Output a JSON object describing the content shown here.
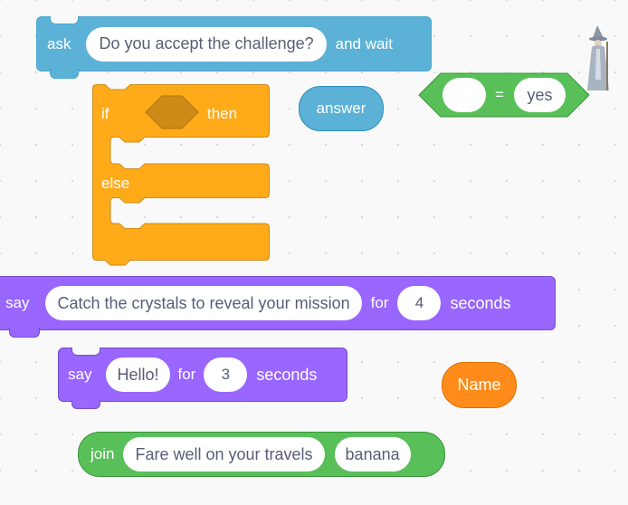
{
  "ask_block": {
    "keyword": "ask",
    "question": "Do you accept the challenge?",
    "suffix": "and wait"
  },
  "answer_reporter": {
    "label": "answer"
  },
  "equals_block": {
    "left_value": "",
    "operator": "=",
    "right_value": "yes"
  },
  "if_else_block": {
    "if_label": "if",
    "then_label": "then",
    "else_label": "else"
  },
  "say_for_block_1": {
    "keyword": "say",
    "message": "Catch the crystals to reveal your mission",
    "for_label": "for",
    "seconds_value": "4",
    "seconds_label": "seconds"
  },
  "say_for_block_2": {
    "keyword": "say",
    "message": "Hello!",
    "for_label": "for",
    "seconds_value": "3",
    "seconds_label": "seconds"
  },
  "name_reporter": {
    "label": "Name"
  },
  "join_block": {
    "keyword": "join",
    "first": "Fare well on your travels",
    "second": "banana"
  },
  "sprite": {
    "icon": "wizard-sprite-icon"
  },
  "colors": {
    "looks": "#9966ff",
    "sensing": "#5cb1d6",
    "control": "#ffab19",
    "operators": "#59c059",
    "variables": "#ff8c1a"
  }
}
